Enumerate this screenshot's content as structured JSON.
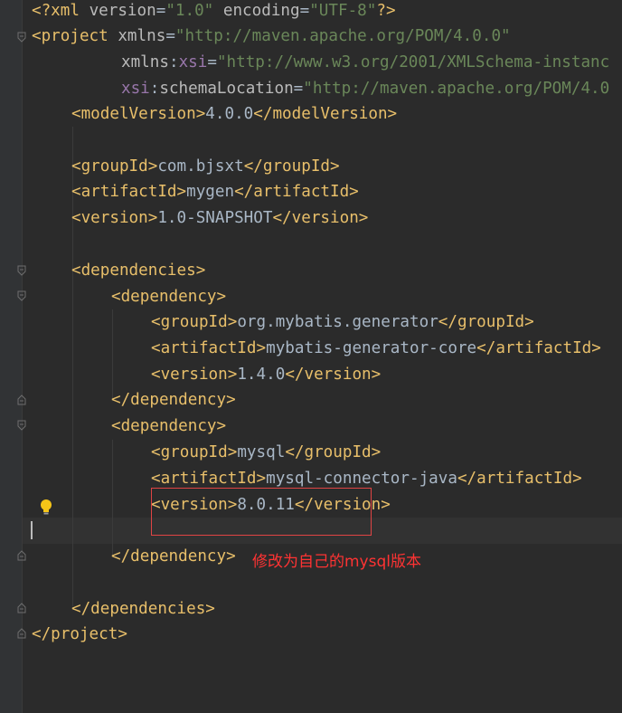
{
  "editor": {
    "lines": [
      {
        "parts": [
          "<?xml ",
          "version",
          "=",
          "\"1.0\"",
          " ",
          "encoding",
          "=",
          "\"UTF-8\"",
          "?>"
        ]
      },
      {
        "parts": [
          "<project ",
          "xmlns",
          "=",
          "\"http://maven.apache.org/POM/4.0.0\""
        ]
      },
      {
        "parts": [
          "xmlns",
          ":",
          "xsi",
          "=",
          "\"http://www.w3.org/2001/XMLSchema-instanc"
        ]
      },
      {
        "parts": [
          "xsi",
          ":",
          "schemaLocation",
          "=",
          "\"http://maven.apache.org/POM/4.0"
        ]
      },
      {
        "parts": [
          "<modelVersion>",
          "4.0.0",
          "</modelVersion>"
        ]
      },
      {
        "parts": [
          "<groupId>",
          "com.bjsxt",
          "</groupId>"
        ]
      },
      {
        "parts": [
          "<artifactId>",
          "mygen",
          "</artifactId>"
        ]
      },
      {
        "parts": [
          "<version>",
          "1.0-SNAPSHOT",
          "</version>"
        ]
      },
      {
        "parts": [
          "<dependencies>"
        ]
      },
      {
        "parts": [
          "<dependency>"
        ]
      },
      {
        "parts": [
          "<groupId>",
          "org.mybatis.generator",
          "</groupId>"
        ]
      },
      {
        "parts": [
          "<artifactId>",
          "mybatis-generator-core",
          "</artifactId>"
        ]
      },
      {
        "parts": [
          "<version>",
          "1.4.0",
          "</version>"
        ]
      },
      {
        "parts": [
          "</dependency>"
        ]
      },
      {
        "parts": [
          "<dependency>"
        ]
      },
      {
        "parts": [
          "<groupId>",
          "mysql",
          "</groupId>"
        ]
      },
      {
        "parts": [
          "<artifactId>",
          "mysql-connector-java",
          "</artifactId>"
        ]
      },
      {
        "parts": [
          "<version>",
          "8.0.11",
          "</version>"
        ]
      },
      {
        "parts": [
          "</dependency>"
        ]
      },
      {
        "parts": [
          "</dependencies>"
        ]
      },
      {
        "parts": [
          "</project>"
        ]
      }
    ]
  },
  "annotation": {
    "text": "修改为自己的mysql版本",
    "color": "#ff3333"
  },
  "icons": {
    "fold": "fold-marker-icon",
    "bulb": "lightbulb-icon"
  },
  "colors": {
    "background": "#2b2b2b",
    "tag": "#e8bf6a",
    "attribute": "#bababa",
    "string": "#6a8759",
    "namespace": "#9876aa",
    "text": "#a9b7c6"
  }
}
